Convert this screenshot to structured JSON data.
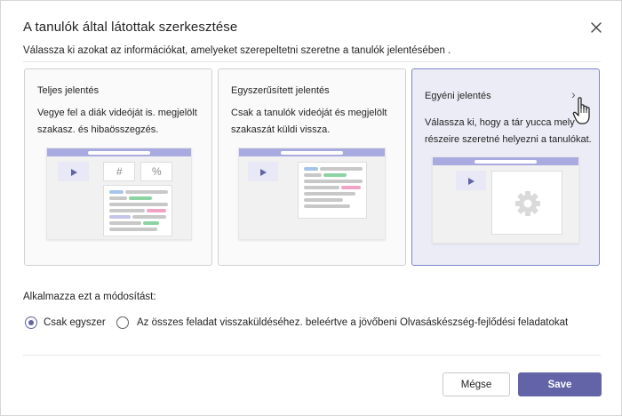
{
  "dialog": {
    "title": "A tanulók által látottak szerkesztése",
    "subtitle": "Válassza ki azokat az információkat, amelyeket szerepeltetni szeretne a tanulók jelentésében ."
  },
  "cards": [
    {
      "title": "Teljes jelentés",
      "description": "Vegye fel a diák videóját is. megjelölt szakasz. és hibaösszegzés.",
      "symbols": [
        "#",
        "%"
      ],
      "selected": false
    },
    {
      "title": "Egyszerűsített jelentés",
      "description": "Csak a tanulók videóját és megjelölt szakaszát küldi vissza.",
      "selected": false
    },
    {
      "title": "Egyéni jelentés",
      "description": "Válassza ki, hogy a tár yucca mely részeire szeretné helyezni a tanulókat.",
      "chevron": "›",
      "selected": true
    }
  ],
  "apply": {
    "label": "Alkalmazza ezt a módosítást:",
    "options": [
      {
        "label": "Csak egyszer",
        "selected": true
      },
      {
        "label": "Az összes feladat visszaküldéséhez. beleértve a jövőbeni Olvasáskészség-fejlődési feladatokat",
        "selected": false
      }
    ]
  },
  "buttons": {
    "cancel": "Mégse",
    "save": "Save"
  },
  "colors": {
    "accent": "#6264a7",
    "selected_card_bg": "#ececf7",
    "illustration_header": "#a9aae0"
  },
  "icons": {
    "close": "close-icon",
    "play": "play-icon",
    "gear": "gear-icon",
    "cursor": "hand-pointer-icon"
  }
}
